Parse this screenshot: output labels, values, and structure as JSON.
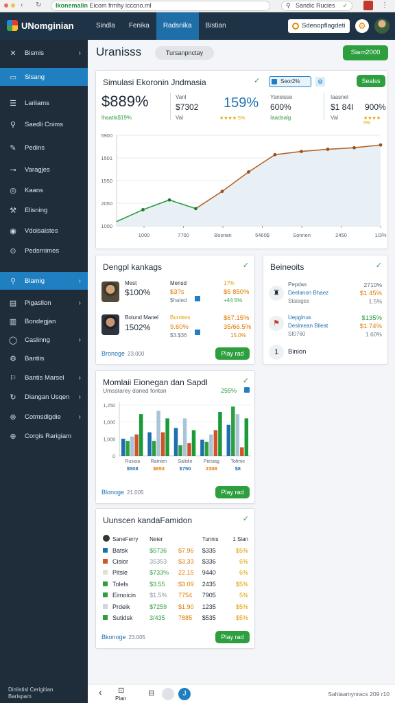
{
  "browser": {
    "url_host": "Ikonemalin",
    "url_path": "Eicom frmhy icccno.ml",
    "search_text": "Sandic Rucies"
  },
  "header": {
    "app_title": "UNomginian",
    "nav": [
      {
        "label": "Sindla",
        "active": false
      },
      {
        "label": "Fenika",
        "active": false
      },
      {
        "label": "Radsnika",
        "active": true
      },
      {
        "label": "Bistian",
        "active": false
      }
    ],
    "button_label": "Sdenopflagdeti",
    "gear_icon": "gear-icon",
    "avatar_icon": "user-avatar"
  },
  "sidebar": {
    "items": [
      {
        "label": "Bismis",
        "icon": "✕",
        "chevron": true,
        "active": false
      },
      {
        "label": "Slsang",
        "icon": "▭",
        "chevron": false,
        "active": true
      },
      {
        "label": "Lariiams",
        "icon": "☰",
        "chevron": false,
        "active": false
      },
      {
        "label": "Saedli Cnims",
        "icon": "⚲",
        "chevron": false,
        "active": false
      },
      {
        "label": "Pedins",
        "icon": "✎",
        "chevron": false,
        "active": false
      },
      {
        "label": "Varagjes",
        "icon": "⊸",
        "chevron": false,
        "active": false
      },
      {
        "label": "Kaans",
        "icon": "◎",
        "chevron": false,
        "active": false
      },
      {
        "label": "Elisning",
        "icon": "⚒",
        "chevron": false,
        "active": false
      },
      {
        "label": "Vdoisalstes",
        "icon": "◉",
        "chevron": false,
        "active": false
      },
      {
        "label": "Pedsrnimes",
        "icon": "⊙",
        "chevron": false,
        "active": false
      },
      {
        "label": "Blamig",
        "icon": "⚲",
        "chevron": true,
        "active": true
      },
      {
        "label": "Pigasllon",
        "icon": "▤",
        "chevron": true,
        "active": false
      },
      {
        "label": "Bondegjan",
        "icon": "▥",
        "chevron": false,
        "active": false
      },
      {
        "label": "Caslinng",
        "icon": "◯",
        "chevron": true,
        "active": false
      },
      {
        "label": "Bantiis",
        "icon": "⚙",
        "chevron": false,
        "active": false
      },
      {
        "label": "Bantis Marsel",
        "icon": "⚐",
        "chevron": true,
        "active": false
      },
      {
        "label": "Diangan Usqen",
        "icon": "↻",
        "chevron": true,
        "active": false
      },
      {
        "label": "Cotmsdlgdie",
        "icon": "⊛",
        "chevron": true,
        "active": false
      },
      {
        "label": "Corgis Rarigiam",
        "icon": "⊕",
        "chevron": false,
        "active": false
      }
    ],
    "footer_line1": "Dinlistisl Cerigitian",
    "footer_line2": "Barispam"
  },
  "main": {
    "title": "Uranisss",
    "title_pill": "Tursanpnctay",
    "primary_button": "Siam2000"
  },
  "econ_card": {
    "title": "Simulasi Ekoronin Jndmasia",
    "metric1": "$889%",
    "metric1_sub": "lhaatla$19%",
    "m2_label": "Vanl",
    "m2_value": "$7302",
    "m2_sub": "Val",
    "metric3": "159%",
    "metric3_sub": "★★★★ 5%",
    "tag_label": "Seor2%",
    "tag_btn": "Sealss",
    "m4_label": "Yaneisse",
    "m4_value": "600%",
    "m4_sub": "Iaadsalg",
    "m5_label": "Iaasnel",
    "m5_value": "$1 84I",
    "m5_sub": "Val",
    "m6_value": "900%",
    "m6_sub": "★★★★ 5%"
  },
  "chart_data": {
    "type": "line",
    "categories": [
      "1000",
      "7700",
      "Bosnan",
      "5460$",
      "Sonnen",
      "2450",
      "1/3%"
    ],
    "series": [
      {
        "values": [
          20,
          75,
          120,
          80,
          160,
          250,
          330,
          345,
          355,
          362,
          375
        ]
      }
    ],
    "y_tick_labels": [
      "1000",
      "2050",
      "1550",
      "1501",
      "5900"
    ],
    "x_positions": [
      0,
      1,
      2,
      3,
      4,
      5,
      6,
      7,
      8,
      9,
      10
    ],
    "ylim": [
      0,
      420
    ],
    "grid": true
  },
  "loans_card": {
    "title": "Dengpl kankags",
    "rows": [
      {
        "c1": "Mest",
        "c2": "$100%",
        "c3": "Mensd",
        "c4": "$3?s",
        "c5": "$hated",
        "c6": "1?%",
        "c7": "$5 850%",
        "c8": "+44 5%"
      },
      {
        "c1": "Bolund Manel",
        "c2": "1502%",
        "c3": "Burnkes",
        "c4": "9.60%",
        "c5": "$3.$36",
        "c6": "",
        "c7": "$67.15%",
        "c8": "35/66.5%"
      }
    ],
    "row2_extra": "15.0%",
    "footer_link": "Bronoge",
    "footer_sub": "23.000",
    "button": "Play rad"
  },
  "benefits_card": {
    "title": "Beineoits",
    "rows": [
      {
        "c1": "Pepdas",
        "c2": "Deelanon Bhaez",
        "c3": "Staiages",
        "v1": "2710%",
        "v2": "$1.45%",
        "v3": "1.5%"
      },
      {
        "c1": "Uepglnus",
        "c2": "Deslmean Bileat",
        "c3": "SI0760",
        "v1": "$135%",
        "v2": "$1.74%",
        "v3": "1.60%"
      }
    ],
    "last_num": "1",
    "last_label": "Binion"
  },
  "bar_card": {
    "title": "Momlaii Eionegan dan Sapdl",
    "subtitle": "Umsstarey daned fontan",
    "badge": "255%",
    "y_tick_labels": [
      "1,250",
      "1,000",
      "1,009",
      "0"
    ],
    "footer_link": "Blonoge",
    "footer_sub": "21.005",
    "button": "Play rad"
  },
  "bar_chart": {
    "type": "bar",
    "categories": [
      "Rusioa",
      "Ramien",
      "Salidin",
      "Piesiag",
      "Tofmie"
    ],
    "category_values": [
      "$508",
      "$853",
      "$750",
      "2308",
      "$8"
    ],
    "series": [
      {
        "color": "#1f6fb0",
        "values": [
          32,
          44,
          52,
          30,
          58
        ]
      },
      {
        "color": "#2e9f3e",
        "values": [
          28,
          28,
          20,
          26,
          92
        ]
      },
      {
        "color": "#a9c4d6",
        "values": [
          36,
          84,
          70,
          40,
          78
        ]
      },
      {
        "color": "#d0542a",
        "values": [
          40,
          44,
          24,
          48,
          16
        ]
      },
      {
        "color": "#1a9a39",
        "values": [
          78,
          70,
          48,
          82,
          70
        ]
      }
    ],
    "ylim": [
      0,
      100
    ]
  },
  "table_card": {
    "title": "Uunscen kandaFamidon",
    "header": [
      "SaneFerry",
      "Neier",
      "",
      "Tunnis",
      "1 Sian"
    ],
    "rows": [
      {
        "swatch": "#1f6fb0",
        "c1": "Batsk",
        "c2": "$5736",
        "c3": "$7.96",
        "c4": "$335",
        "c5": "$5%"
      },
      {
        "swatch": "#d0542a",
        "c1": "Cisior",
        "c2": "35353",
        "c3": "$3.33",
        "c4": "$336",
        "c5": "6%"
      },
      {
        "swatch": "#e6dfcf",
        "c1": "Pitsle",
        "c2": "$733%",
        "c3": "22.15",
        "c4": "9440",
        "c5": "6%"
      },
      {
        "swatch": "#2e9f3e",
        "c1": "Tolels",
        "c2": "$3.55",
        "c3": "$3.09",
        "c4": "2435",
        "c5": "$5%"
      },
      {
        "swatch": "#2e9f3e",
        "c1": "Eimoicin",
        "c2": "$1.5%",
        "c3": "7754",
        "c4": "7905",
        "c5": "5%"
      },
      {
        "swatch": "#d0d6dd",
        "c1": "Prdeik",
        "c2": "$7259",
        "c3": "$1.90",
        "c4": "1235",
        "c5": "$5%"
      },
      {
        "swatch": "#2e9f3e",
        "c1": "Sutidsk",
        "c2": "3/435",
        "c3": "7885",
        "c4": "$535",
        "c5": "$5%"
      }
    ],
    "footer_link": "Bkonoge",
    "footer_sub": "23.005",
    "button": "Play rad"
  },
  "bottom_bar": {
    "left_icon": "back-icon",
    "page_label": "Pian",
    "right_text": "Sahlaamynracs 209 r10"
  }
}
